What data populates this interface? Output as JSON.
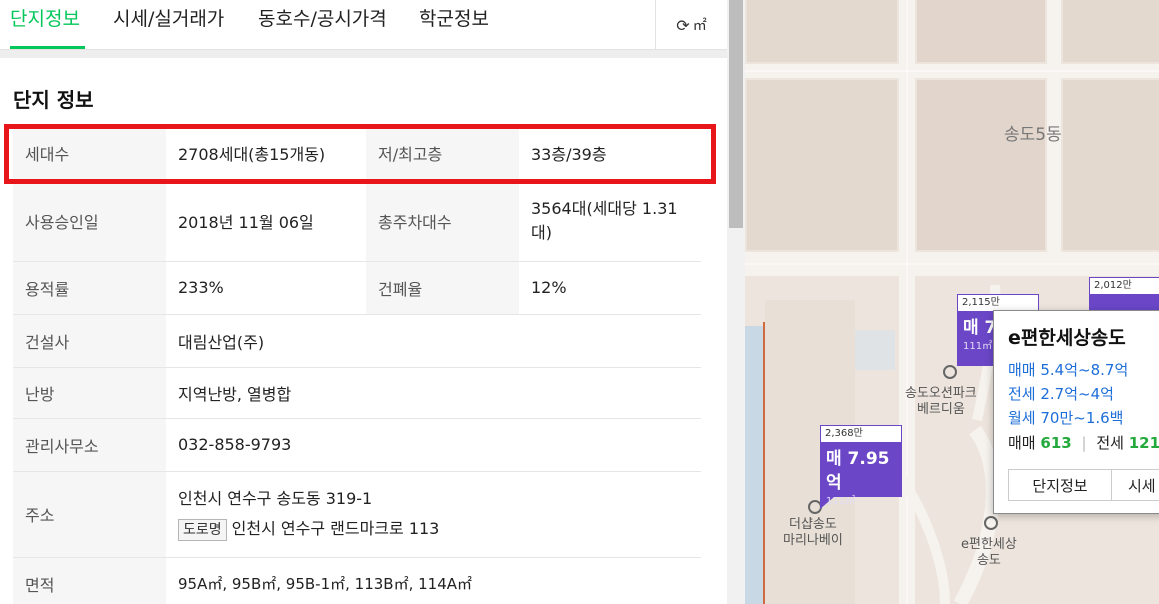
{
  "tabs": [
    {
      "label": "단지정보",
      "active": true
    },
    {
      "label": "시세/실거래가",
      "active": false
    },
    {
      "label": "동호수/공시가격",
      "active": false
    },
    {
      "label": "학군정보",
      "active": false
    }
  ],
  "unit_button": {
    "icon": "refresh-icon",
    "label": "㎡"
  },
  "section_title": "단지 정보",
  "info": {
    "households_label": "세대수",
    "households_value": "2708세대(총15개동)",
    "floors_label": "저/최고층",
    "floors_value": "33층/39층",
    "approval_label": "사용승인일",
    "approval_value": "2018년 11월 06일",
    "parking_label": "총주차대수",
    "parking_value": "3564대(세대당 1.31대)",
    "far_label": "용적률",
    "far_value": "233%",
    "bcr_label": "건폐율",
    "bcr_value": "12%",
    "builder_label": "건설사",
    "builder_value": "대림산업(주)",
    "heating_label": "난방",
    "heating_value": "지역난방, 열병합",
    "office_label": "관리사무소",
    "office_value": "032-858-9793",
    "address_label": "주소",
    "address_jibun": "인천시 연수구 송도동 319-1",
    "address_road_badge": "도로명",
    "address_road": "인천시 연수구 랜드마크로 113",
    "area_label": "면적",
    "area_value": "95A㎡, 95B㎡, 95B-1㎡, 113B㎡, 114A㎡"
  },
  "map": {
    "dong_label": "송도5동",
    "places": [
      {
        "line1": "송도오션파크",
        "line2": "베르디움"
      },
      {
        "line1": "더샵송도",
        "line2": "마리나베이"
      },
      {
        "line1": "e편한세상",
        "line2": "송도"
      }
    ],
    "markers": [
      {
        "price_per": "2,115만",
        "big": "매 7.",
        "area": "111㎡"
      },
      {
        "price_per": "2,012만",
        "big": "",
        "area": ""
      },
      {
        "price_per": "2,368만",
        "big": "매 7.95억",
        "area": "111㎡"
      }
    ],
    "popup": {
      "title": "e편한세상송도",
      "sale": "매매 5.4억~8.7억",
      "jeonse": "전세 2.7억~4억",
      "monthly": "월세 70만~1.6백",
      "sale_count_label": "매매",
      "sale_count": "613",
      "jeonse_count_label": "전세",
      "jeonse_count": "121",
      "btn_info": "단지정보",
      "btn_price": "시세"
    }
  },
  "colors": {
    "accent": "#03c75a",
    "highlight": "#e8151b",
    "marker": "#6b47c8"
  }
}
